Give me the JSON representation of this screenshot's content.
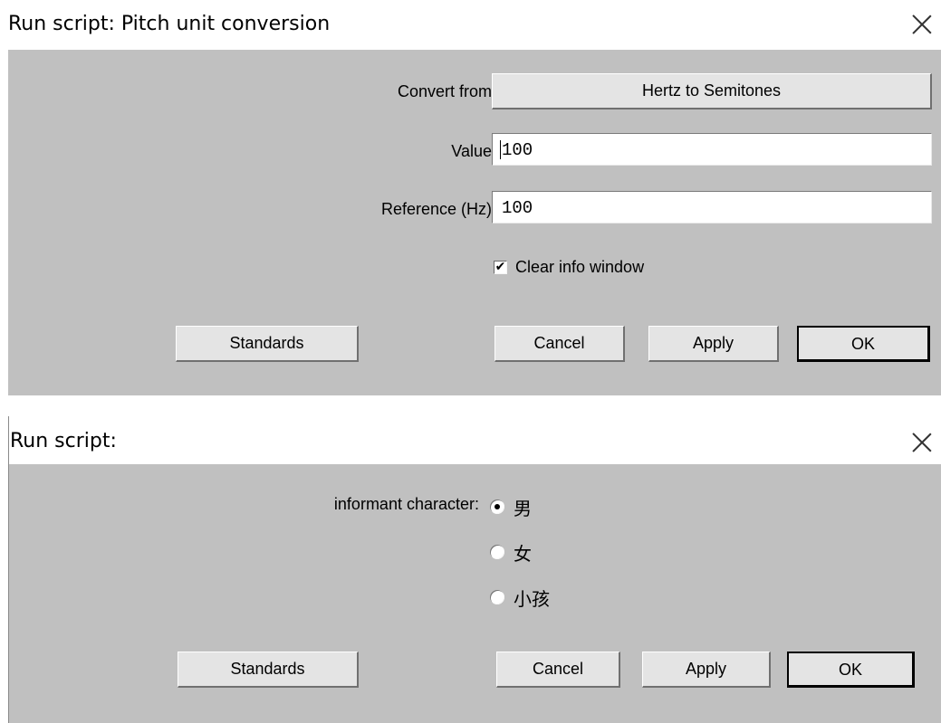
{
  "dialog1": {
    "title": "Run script: Pitch unit conversion",
    "convert_from_label": "Convert from:",
    "convert_from_value": "Hertz to Semitones",
    "value_label": "Value:",
    "value": "100",
    "reference_label": "Reference (Hz):",
    "reference_value": "100",
    "clear_info_label": "Clear info window",
    "clear_info_checked": true,
    "check_glyph": "✔",
    "buttons": {
      "standards": "Standards",
      "cancel": "Cancel",
      "apply": "Apply",
      "ok": "OK"
    }
  },
  "dialog2": {
    "title": "Run script:",
    "radio_label": "informant character:",
    "options": [
      "男",
      "女",
      "小孩"
    ],
    "selected_index": 0,
    "buttons": {
      "standards": "Standards",
      "cancel": "Cancel",
      "apply": "Apply",
      "ok": "OK"
    }
  }
}
